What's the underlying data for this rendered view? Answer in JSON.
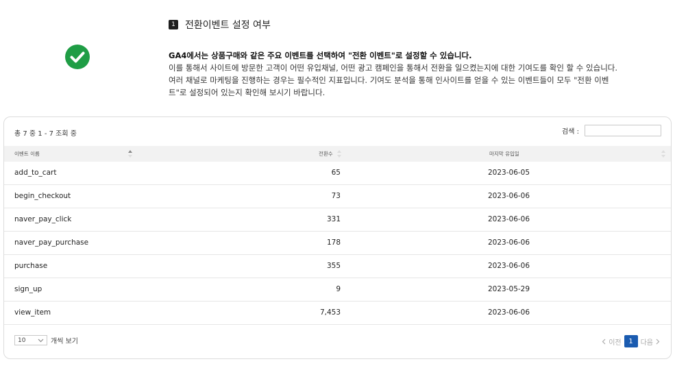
{
  "section": {
    "number": "1",
    "title": "전환이벤트 설정 여부"
  },
  "info": {
    "bold": "GA4에서는 상품구매와 같은 주요 이벤트를 선택하여 \"전환 이벤트\"로 설정할 수 있습니다.",
    "body": "이를 통해서 사이트에 방문한 고객이 어떤 유입채널, 어떤 광고 캠페인을 통해서 전환을 일으켰는지에 대한 기여도를 확인 할 수 있습니다. 여러 채널로 마케팅을 진행하는 경우는 필수적인 지표입니다. 기여도 분석을 통해 인사이트를 얻을 수 있는 이벤트들이 모두 \"전환 이벤트\"로 설정되어 있는지 확인해 보시기 바랍니다."
  },
  "table": {
    "summary": "총 7 중 1 - 7 조회 중",
    "search_label": "검색 :",
    "search_value": "",
    "columns": [
      "이벤트 이름",
      "전환수",
      "마지막 유입일"
    ],
    "rows": [
      {
        "name": "add_to_cart",
        "count": "65",
        "date": "2023-06-05"
      },
      {
        "name": "begin_checkout",
        "count": "73",
        "date": "2023-06-06"
      },
      {
        "name": "naver_pay_click",
        "count": "331",
        "date": "2023-06-06"
      },
      {
        "name": "naver_pay_purchase",
        "count": "178",
        "date": "2023-06-06"
      },
      {
        "name": "purchase",
        "count": "355",
        "date": "2023-06-06"
      },
      {
        "name": "sign_up",
        "count": "9",
        "date": "2023-05-29"
      },
      {
        "name": "view_item",
        "count": "7,453",
        "date": "2023-06-06"
      }
    ],
    "page_size": "10",
    "page_size_suffix": "개씩 보기",
    "pager": {
      "prev": "이전",
      "current": "1",
      "next": "다음"
    }
  },
  "colors": {
    "check": "#1f9d45",
    "page_active": "#1a5bb0",
    "header_bg": "#f2f2f2"
  }
}
